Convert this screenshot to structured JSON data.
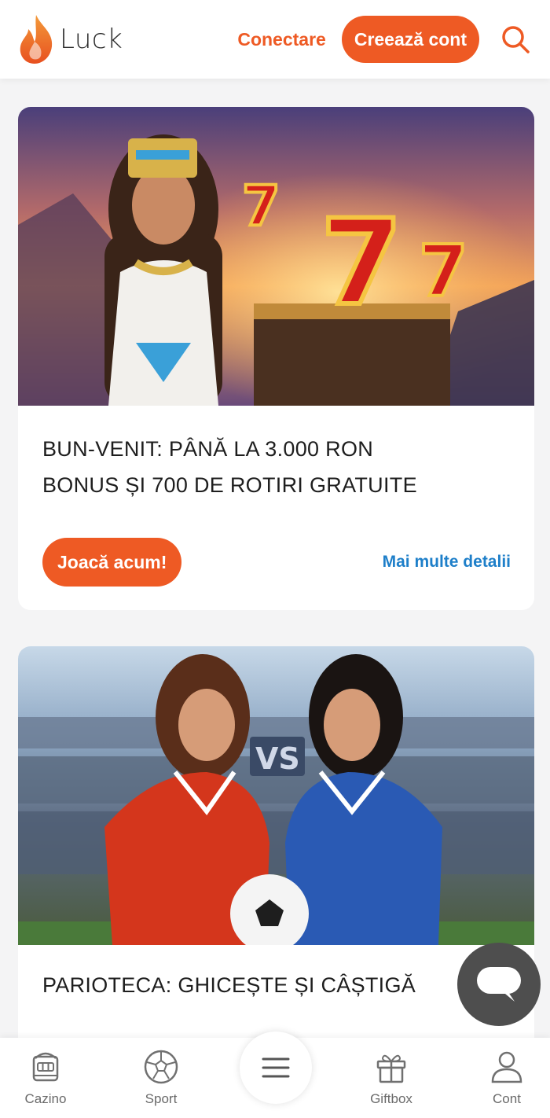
{
  "header": {
    "logo_text": "Luck",
    "login_label": "Conectare",
    "signup_label": "Creează cont",
    "search_icon": "search-icon"
  },
  "promos": [
    {
      "title_line1": "BUN-VENIT: PÂNĂ LA 3.000 RON",
      "title_line2": "BONUS ȘI 700 DE ROTIRI GRATUITE",
      "cta_label": "Joacă acum!",
      "details_label": "Mai multe detalii",
      "image_icon": "egyptian-queen-slots-banner"
    },
    {
      "title_line1": "PARIOTECA: GHICEȘTE ȘI CÂȘTIGĂ",
      "image_icon": "football-vs-banner",
      "vs_text": "VS"
    }
  ],
  "chat": {
    "icon": "chat-bubble-icon"
  },
  "bottom_nav": {
    "items": [
      {
        "label": "Cazino",
        "icon": "slot-machine-icon"
      },
      {
        "label": "Sport",
        "icon": "soccer-ball-icon"
      },
      {
        "label": "",
        "icon": "hamburger-menu-icon"
      },
      {
        "label": "Giftbox",
        "icon": "gift-icon"
      },
      {
        "label": "Cont",
        "icon": "user-icon"
      }
    ]
  },
  "colors": {
    "accent": "#ee5a24",
    "link": "#1e7fc9",
    "chat": "#4e4e4e"
  }
}
